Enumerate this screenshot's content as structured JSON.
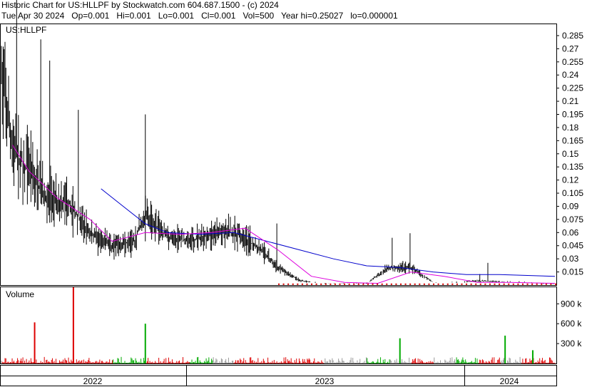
{
  "header": {
    "line1": "Historic Chart for US:HLLPF by Stockwatch.com 604.687.1500 - (c) 2024",
    "line2": "Tue Apr 30 2024   Op=0.001   Hi=0.001   Lo=0.001   Cl=0.001   Vol=500   Year hi=0.25027   lo=0.000001"
  },
  "colors": {
    "price_bars": "#000000",
    "ma_short": "#dd00dd",
    "ma_long": "#0000cc",
    "volume_up": "#00aa00",
    "volume_down": "#dd0000",
    "volume_flat": "#999999",
    "low_marker": "#dd0000"
  },
  "chart_data": [
    {
      "type": "ohlc",
      "title": "US:HLLPF",
      "y_ticks": [
        "0.285",
        "0.27",
        "0.255",
        "0.24",
        "0.225",
        "0.21",
        "0.195",
        "0.18",
        "0.165",
        "0.15",
        "0.135",
        "0.12",
        "0.105",
        "0.09",
        "0.075",
        "0.06",
        "0.045",
        "0.03",
        "0.015"
      ],
      "ylim": [
        0,
        0.298
      ],
      "x_labels": [
        "2022",
        "2023",
        "2024"
      ],
      "series": [
        {
          "x": [
            0,
            0.02,
            0.05,
            0.08,
            0.12,
            0.16,
            0.2,
            0.24,
            0.26,
            0.3,
            0.34,
            0.38,
            0.42,
            0.46,
            0.5,
            0.54,
            0.58,
            0.62,
            0.66,
            0.7,
            0.74,
            0.78,
            0.82,
            0.86,
            0.9,
            0.94,
            1.0
          ],
          "close": [
            0.24,
            0.155,
            0.13,
            0.1,
            0.095,
            0.06,
            0.045,
            0.05,
            0.08,
            0.055,
            0.05,
            0.06,
            0.06,
            0.045,
            0.02,
            0.005,
            0.002,
            0.002,
            0.002,
            0.02,
            0.02,
            0.003,
            0.003,
            0.005,
            0.004,
            0.004,
            0.001
          ]
        },
        {
          "x": [
            0.02,
            0.05,
            0.1,
            0.16,
            0.2,
            0.26,
            0.32,
            0.38,
            0.44,
            0.5,
            0.56,
            0.62,
            0.68,
            0.74,
            0.8,
            0.86,
            0.92,
            1.0
          ],
          "ma_short": [
            0.16,
            0.13,
            0.1,
            0.075,
            0.05,
            0.06,
            0.058,
            0.06,
            0.065,
            0.04,
            0.01,
            0.003,
            0.002,
            0.015,
            0.01,
            0.003,
            0.003,
            0.002
          ]
        },
        {
          "x": [
            0.18,
            0.22,
            0.26,
            0.3,
            0.36,
            0.42,
            0.48,
            0.54,
            0.6,
            0.66,
            0.72,
            0.78,
            0.84,
            0.9,
            1.0
          ],
          "ma_long": [
            0.11,
            0.09,
            0.07,
            0.06,
            0.058,
            0.06,
            0.05,
            0.04,
            0.03,
            0.022,
            0.02,
            0.015,
            0.012,
            0.012,
            0.01
          ]
        }
      ]
    },
    {
      "type": "bar",
      "title": "Volume",
      "y_ticks": [
        "900 k",
        "600 k",
        "300 k"
      ],
      "ylim": [
        0,
        1150
      ],
      "units": "k",
      "highlights": [
        {
          "x": 0.06,
          "value": 620,
          "color": "down"
        },
        {
          "x": 0.13,
          "value": 1150,
          "color": "down"
        },
        {
          "x": 0.26,
          "value": 600,
          "color": "up"
        },
        {
          "x": 0.72,
          "value": 380,
          "color": "up"
        },
        {
          "x": 0.91,
          "value": 420,
          "color": "up"
        },
        {
          "x": 0.96,
          "value": 200,
          "color": "up"
        }
      ]
    }
  ]
}
